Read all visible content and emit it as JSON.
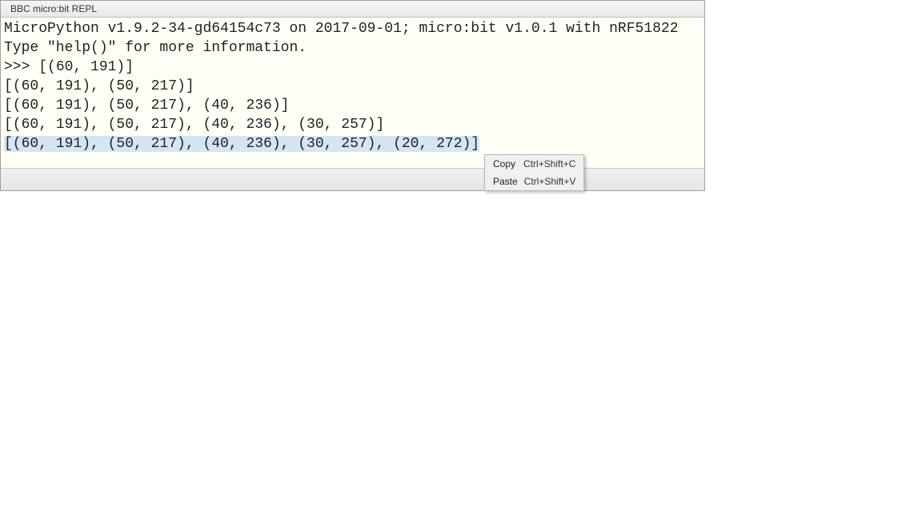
{
  "panel": {
    "title": "BBC micro:bit REPL"
  },
  "repl": {
    "line1": "MicroPython v1.9.2-34-gd64154c73 on 2017-09-01; micro:bit v1.0.1 with nRF51822",
    "line2": "Type \"help()\" for more information.",
    "line3_prompt": ">>> ",
    "line3_rest": "[(60, 191)]",
    "line4": "[(60, 191), (50, 217)]",
    "line5": "[(60, 191), (50, 217), (40, 236)]",
    "line6": "[(60, 191), (50, 217), (40, 236), (30, 257)]",
    "line7_selected": "[(60, 191), (50, 217), (40, 236), (30, 257), (20, 272)]"
  },
  "context_menu": {
    "items": [
      {
        "label": "Copy",
        "shortcut": "Ctrl+Shift+C"
      },
      {
        "label": "Paste",
        "shortcut": "Ctrl+Shift+V"
      }
    ]
  }
}
